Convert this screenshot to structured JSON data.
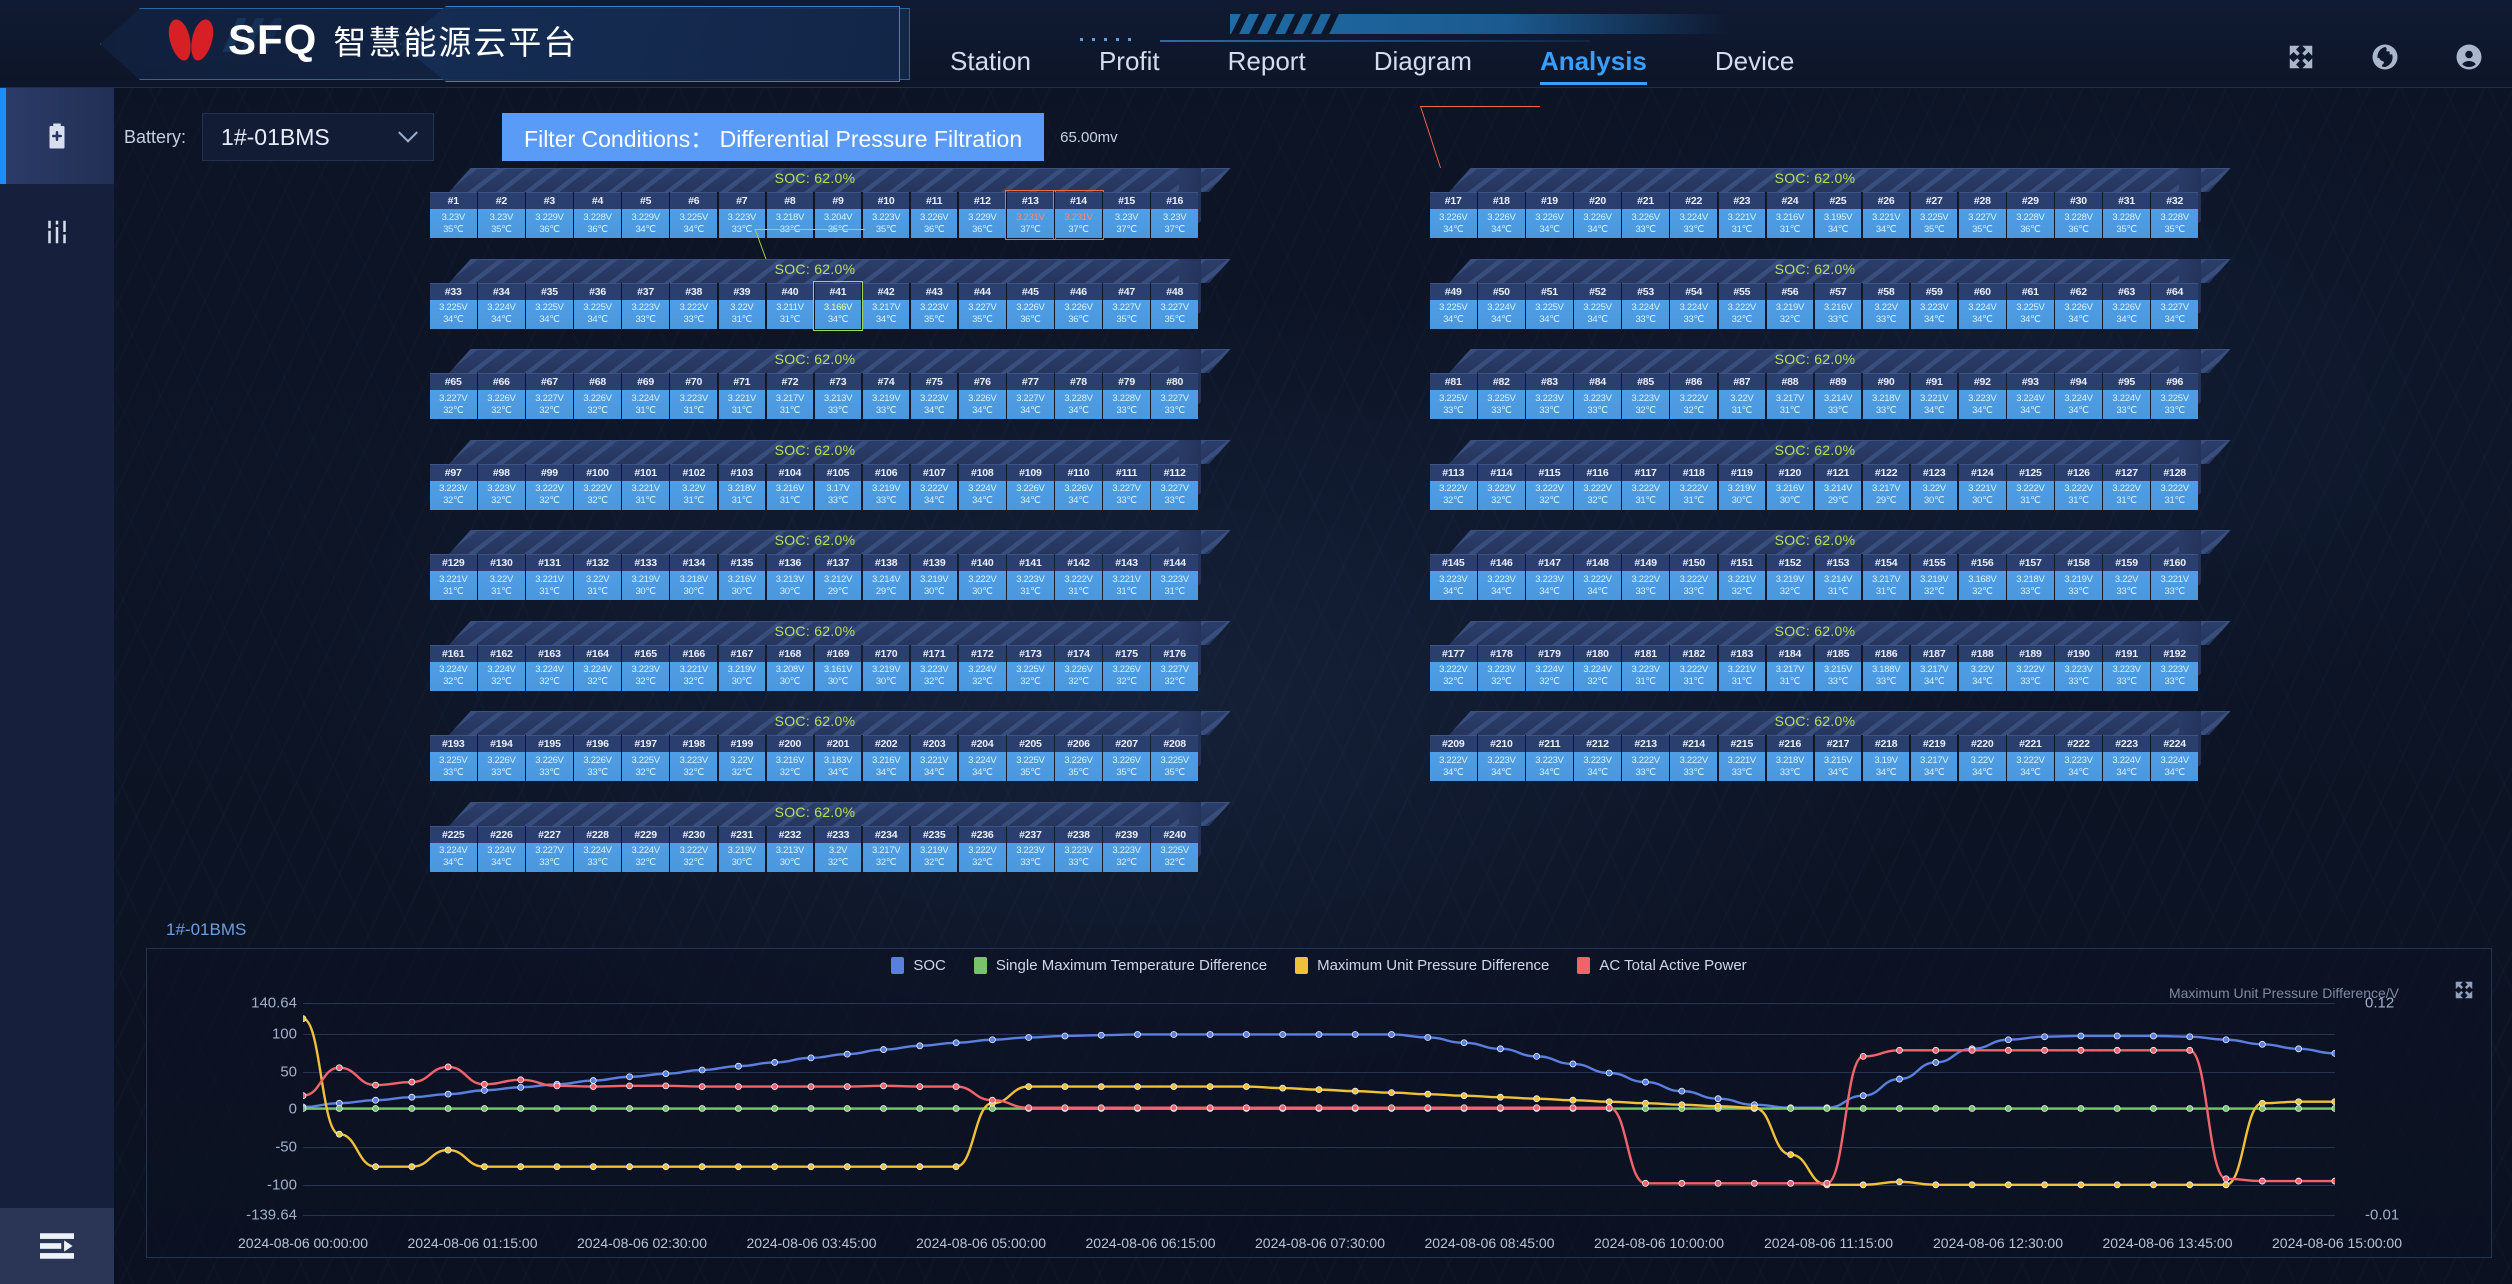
{
  "header": {
    "brand": "SFQ",
    "brand_sub": "智慧能源云平台",
    "nav": [
      {
        "label": "Station",
        "active": false
      },
      {
        "label": "Profit",
        "active": false
      },
      {
        "label": "Report",
        "active": false
      },
      {
        "label": "Diagram",
        "active": false
      },
      {
        "label": "Analysis",
        "active": true
      },
      {
        "label": "Device",
        "active": false
      }
    ],
    "icons": [
      "fullscreen-icon",
      "globe-icon",
      "user-icon"
    ]
  },
  "sidebar": {
    "items": [
      {
        "icon": "battery-clipboard-icon",
        "active": true
      },
      {
        "icon": "sliders-icon",
        "active": false
      }
    ],
    "bottom_icon": "menu-collapse-icon"
  },
  "filter": {
    "battery_label": "Battery:",
    "battery_value": "1#-01BMS",
    "chip_label": "Filter Conditions： Differential Pressure Filtration",
    "chip_value": "65.00mv"
  },
  "packs": {
    "soc_label": "SOC: 62.0%",
    "left": [
      {
        "start": 1,
        "voltages": [
          "3.23V",
          "3.23V",
          "3.229V",
          "3.228V",
          "3.229V",
          "3.225V",
          "3.223V",
          "3.218V",
          "3.204V",
          "3.223V",
          "3.226V",
          "3.229V",
          "3.231V",
          "3.231V",
          "3.23V",
          "3.23V"
        ],
        "temps": [
          "35℃",
          "35℃",
          "36℃",
          "36℃",
          "34℃",
          "34℃",
          "33℃",
          "33℃",
          "35℃",
          "35℃",
          "36℃",
          "36℃",
          "37℃",
          "37℃",
          "37℃",
          "37℃"
        ],
        "highlight": {
          "red": [
            13,
            14
          ]
        }
      },
      {
        "start": 33,
        "voltages": [
          "3.225V",
          "3.224V",
          "3.225V",
          "3.225V",
          "3.223V",
          "3.222V",
          "3.22V",
          "3.211V",
          "3.166V",
          "3.217V",
          "3.223V",
          "3.227V",
          "3.226V",
          "3.226V",
          "3.227V",
          "3.227V"
        ],
        "temps": [
          "34℃",
          "34℃",
          "34℃",
          "34℃",
          "33℃",
          "33℃",
          "31℃",
          "31℃",
          "34℃",
          "34℃",
          "35℃",
          "35℃",
          "36℃",
          "36℃",
          "35℃",
          "35℃"
        ],
        "highlight": {
          "green": [
            41
          ]
        }
      },
      {
        "start": 65,
        "voltages": [
          "3.227V",
          "3.226V",
          "3.227V",
          "3.226V",
          "3.224V",
          "3.223V",
          "3.221V",
          "3.217V",
          "3.213V",
          "3.219V",
          "3.223V",
          "3.226V",
          "3.227V",
          "3.228V",
          "3.228V",
          "3.227V"
        ],
        "temps": [
          "32℃",
          "32℃",
          "32℃",
          "32℃",
          "31℃",
          "31℃",
          "31℃",
          "31℃",
          "33℃",
          "33℃",
          "34℃",
          "34℃",
          "34℃",
          "34℃",
          "33℃",
          "33℃"
        ],
        "highlight": {}
      },
      {
        "start": 97,
        "voltages": [
          "3.223V",
          "3.223V",
          "3.222V",
          "3.222V",
          "3.221V",
          "3.22V",
          "3.218V",
          "3.216V",
          "3.17V",
          "3.219V",
          "3.222V",
          "3.224V",
          "3.226V",
          "3.226V",
          "3.227V",
          "3.227V"
        ],
        "temps": [
          "32℃",
          "32℃",
          "32℃",
          "32℃",
          "31℃",
          "31℃",
          "31℃",
          "31℃",
          "33℃",
          "33℃",
          "34℃",
          "34℃",
          "34℃",
          "34℃",
          "33℃",
          "33℃"
        ],
        "highlight": {}
      },
      {
        "start": 129,
        "voltages": [
          "3.221V",
          "3.22V",
          "3.221V",
          "3.22V",
          "3.219V",
          "3.218V",
          "3.216V",
          "3.213V",
          "3.212V",
          "3.214V",
          "3.219V",
          "3.222V",
          "3.223V",
          "3.222V",
          "3.221V",
          "3.223V"
        ],
        "temps": [
          "31℃",
          "31℃",
          "31℃",
          "31℃",
          "30℃",
          "30℃",
          "30℃",
          "30℃",
          "29℃",
          "29℃",
          "30℃",
          "30℃",
          "31℃",
          "31℃",
          "31℃",
          "31℃"
        ],
        "highlight": {}
      },
      {
        "start": 161,
        "voltages": [
          "3.224V",
          "3.224V",
          "3.224V",
          "3.224V",
          "3.223V",
          "3.221V",
          "3.219V",
          "3.208V",
          "3.161V",
          "3.219V",
          "3.223V",
          "3.224V",
          "3.225V",
          "3.226V",
          "3.226V",
          "3.227V"
        ],
        "temps": [
          "32℃",
          "32℃",
          "32℃",
          "32℃",
          "32℃",
          "32℃",
          "30℃",
          "30℃",
          "30℃",
          "30℃",
          "32℃",
          "32℃",
          "32℃",
          "32℃",
          "32℃",
          "32℃"
        ],
        "highlight": {}
      },
      {
        "start": 193,
        "voltages": [
          "3.225V",
          "3.226V",
          "3.226V",
          "3.226V",
          "3.225V",
          "3.223V",
          "3.22V",
          "3.216V",
          "3.183V",
          "3.216V",
          "3.221V",
          "3.224V",
          "3.225V",
          "3.226V",
          "3.226V",
          "3.225V"
        ],
        "temps": [
          "33℃",
          "33℃",
          "33℃",
          "33℃",
          "32℃",
          "32℃",
          "32℃",
          "32℃",
          "34℃",
          "34℃",
          "34℃",
          "34℃",
          "35℃",
          "35℃",
          "35℃",
          "35℃"
        ],
        "highlight": {}
      },
      {
        "start": 225,
        "voltages": [
          "3.224V",
          "3.224V",
          "3.227V",
          "3.224V",
          "3.224V",
          "3.222V",
          "3.219V",
          "3.213V",
          "3.2V",
          "3.217V",
          "3.219V",
          "3.222V",
          "3.223V",
          "3.223V",
          "3.223V",
          "3.225V"
        ],
        "temps": [
          "34℃",
          "34℃",
          "33℃",
          "33℃",
          "32℃",
          "32℃",
          "30℃",
          "30℃",
          "32℃",
          "32℃",
          "32℃",
          "32℃",
          "33℃",
          "33℃",
          "32℃",
          "32℃"
        ],
        "highlight": {}
      }
    ],
    "right": [
      {
        "start": 17,
        "voltages": [
          "3.226V",
          "3.226V",
          "3.226V",
          "3.226V",
          "3.226V",
          "3.224V",
          "3.221V",
          "3.216V",
          "3.195V",
          "3.221V",
          "3.225V",
          "3.227V",
          "3.228V",
          "3.228V",
          "3.228V",
          "3.228V"
        ],
        "temps": [
          "34℃",
          "34℃",
          "34℃",
          "34℃",
          "33℃",
          "33℃",
          "31℃",
          "31℃",
          "34℃",
          "34℃",
          "35℃",
          "35℃",
          "36℃",
          "36℃",
          "35℃",
          "35℃"
        ],
        "highlight": {}
      },
      {
        "start": 49,
        "voltages": [
          "3.225V",
          "3.224V",
          "3.225V",
          "3.225V",
          "3.224V",
          "3.224V",
          "3.222V",
          "3.219V",
          "3.216V",
          "3.22V",
          "3.223V",
          "3.224V",
          "3.225V",
          "3.226V",
          "3.226V",
          "3.227V"
        ],
        "temps": [
          "34℃",
          "34℃",
          "34℃",
          "34℃",
          "33℃",
          "33℃",
          "32℃",
          "32℃",
          "33℃",
          "33℃",
          "34℃",
          "34℃",
          "34℃",
          "34℃",
          "34℃",
          "34℃"
        ],
        "highlight": {}
      },
      {
        "start": 81,
        "voltages": [
          "3.225V",
          "3.225V",
          "3.223V",
          "3.223V",
          "3.223V",
          "3.222V",
          "3.22V",
          "3.217V",
          "3.214V",
          "3.218V",
          "3.221V",
          "3.223V",
          "3.224V",
          "3.224V",
          "3.224V",
          "3.225V"
        ],
        "temps": [
          "33℃",
          "33℃",
          "33℃",
          "33℃",
          "32℃",
          "32℃",
          "31℃",
          "31℃",
          "33℃",
          "33℃",
          "34℃",
          "34℃",
          "34℃",
          "34℃",
          "33℃",
          "33℃"
        ],
        "highlight": {}
      },
      {
        "start": 113,
        "voltages": [
          "3.222V",
          "3.222V",
          "3.222V",
          "3.222V",
          "3.222V",
          "3.222V",
          "3.219V",
          "3.216V",
          "3.214V",
          "3.217V",
          "3.22V",
          "3.221V",
          "3.222V",
          "3.222V",
          "3.222V",
          "3.222V"
        ],
        "temps": [
          "32℃",
          "32℃",
          "32℃",
          "32℃",
          "31℃",
          "31℃",
          "30℃",
          "30℃",
          "29℃",
          "29℃",
          "30℃",
          "30℃",
          "31℃",
          "31℃",
          "31℃",
          "31℃"
        ],
        "highlight": {}
      },
      {
        "start": 145,
        "voltages": [
          "3.223V",
          "3.223V",
          "3.223V",
          "3.222V",
          "3.222V",
          "3.222V",
          "3.221V",
          "3.219V",
          "3.214V",
          "3.217V",
          "3.219V",
          "3.168V",
          "3.218V",
          "3.219V",
          "3.22V",
          "3.221V"
        ],
        "temps": [
          "34℃",
          "34℃",
          "34℃",
          "34℃",
          "33℃",
          "33℃",
          "32℃",
          "32℃",
          "31℃",
          "31℃",
          "32℃",
          "32℃",
          "33℃",
          "33℃",
          "33℃",
          "33℃"
        ],
        "highlight": {}
      },
      {
        "start": 177,
        "voltages": [
          "3.222V",
          "3.223V",
          "3.224V",
          "3.224V",
          "3.223V",
          "3.222V",
          "3.221V",
          "3.217V",
          "3.215V",
          "3.188V",
          "3.217V",
          "3.22V",
          "3.222V",
          "3.223V",
          "3.223V",
          "3.223V"
        ],
        "temps": [
          "32℃",
          "32℃",
          "32℃",
          "32℃",
          "31℃",
          "31℃",
          "31℃",
          "31℃",
          "33℃",
          "33℃",
          "34℃",
          "34℃",
          "33℃",
          "33℃",
          "33℃",
          "33℃"
        ],
        "highlight": {}
      },
      {
        "start": 209,
        "voltages": [
          "3.222V",
          "3.223V",
          "3.223V",
          "3.223V",
          "3.222V",
          "3.222V",
          "3.221V",
          "3.218V",
          "3.215V",
          "3.19V",
          "3.217V",
          "3.22V",
          "3.222V",
          "3.223V",
          "3.224V",
          "3.224V"
        ],
        "temps": [
          "34℃",
          "34℃",
          "34℃",
          "34℃",
          "33℃",
          "33℃",
          "33℃",
          "33℃",
          "34℃",
          "34℃",
          "34℃",
          "34℃",
          "34℃",
          "34℃",
          "34℃",
          "34℃"
        ],
        "highlight": {}
      }
    ]
  },
  "chart_data": {
    "type": "line",
    "title": "1#-01BMS",
    "xlabel": "",
    "ylabel": "",
    "right_axis_title": "Maximum Unit Pressure Difference/V",
    "legend_position": "top-center",
    "grid": true,
    "ylim": [
      -139.64,
      140.64
    ],
    "yticks": [
      "140.64",
      "100",
      "50",
      "0",
      "-50",
      "-100",
      "-139.64"
    ],
    "right_ylim": [
      -0.01,
      0.12
    ],
    "right_yticks": [
      "0.12",
      "-0.01"
    ],
    "x": [
      "2024-08-06 00:00:00",
      "2024-08-06 01:15:00",
      "2024-08-06 02:30:00",
      "2024-08-06 03:45:00",
      "2024-08-06 05:00:00",
      "2024-08-06 06:15:00",
      "2024-08-06 07:30:00",
      "2024-08-06 08:45:00",
      "2024-08-06 10:00:00",
      "2024-08-06 11:15:00",
      "2024-08-06 12:30:00",
      "2024-08-06 13:45:00",
      "2024-08-06 15:00:00"
    ],
    "series": [
      {
        "name": "SOC",
        "color": "#5b7fe0",
        "values": [
          3,
          8,
          12,
          16,
          20,
          25,
          29,
          33,
          38,
          43,
          47,
          52,
          57,
          62,
          68,
          73,
          79,
          84,
          88,
          92,
          95,
          97,
          98,
          99,
          99,
          99,
          99,
          99,
          99,
          99,
          99,
          95,
          88,
          80,
          70,
          60,
          48,
          36,
          24,
          14,
          6,
          2,
          2,
          18,
          40,
          62,
          80,
          92,
          96,
          97,
          97,
          97,
          96,
          92,
          86,
          80,
          74
        ]
      },
      {
        "name": "Single Maximum Temperature Difference",
        "color": "#79c46a",
        "values": [
          1,
          1,
          1,
          1,
          1,
          1,
          1,
          1,
          1,
          1,
          1,
          1,
          1,
          1,
          1,
          1,
          1,
          1,
          1,
          1,
          1,
          1,
          1,
          1,
          1,
          1,
          1,
          1,
          1,
          1,
          1,
          1,
          1,
          1,
          1,
          1,
          1,
          1,
          1,
          1,
          1,
          1,
          1,
          1,
          1,
          1,
          1,
          1,
          1,
          1,
          1,
          1,
          1,
          1,
          1,
          1,
          1
        ]
      },
      {
        "name": "Maximum Unit Pressure Difference",
        "color": "#f0c03a",
        "values": [
          120,
          -33,
          -76,
          -76,
          -54,
          -76,
          -76,
          -76,
          -76,
          -76,
          -76,
          -76,
          -76,
          -76,
          -76,
          -76,
          -76,
          -76,
          -76,
          8,
          30,
          30,
          30,
          30,
          30,
          30,
          30,
          28,
          26,
          24,
          22,
          20,
          18,
          16,
          14,
          12,
          10,
          8,
          6,
          4,
          2,
          -60,
          -100,
          -100,
          -96,
          -100,
          -100,
          -100,
          -100,
          -100,
          -100,
          -100,
          -100,
          -100,
          8,
          10,
          10
        ]
      },
      {
        "name": "AC Total Active Power",
        "color": "#f2636b",
        "values": [
          18,
          55,
          32,
          36,
          56,
          33,
          39,
          31,
          30,
          31,
          31,
          30,
          30,
          30,
          30,
          30,
          31,
          30,
          30,
          12,
          2,
          2,
          2,
          2,
          2,
          2,
          2,
          2,
          2,
          2,
          2,
          2,
          2,
          2,
          2,
          2,
          2,
          -98,
          -98,
          -98,
          -98,
          -98,
          -98,
          70,
          78,
          78,
          78,
          78,
          78,
          78,
          78,
          78,
          78,
          -92,
          -95,
          -95,
          -95
        ]
      }
    ]
  }
}
